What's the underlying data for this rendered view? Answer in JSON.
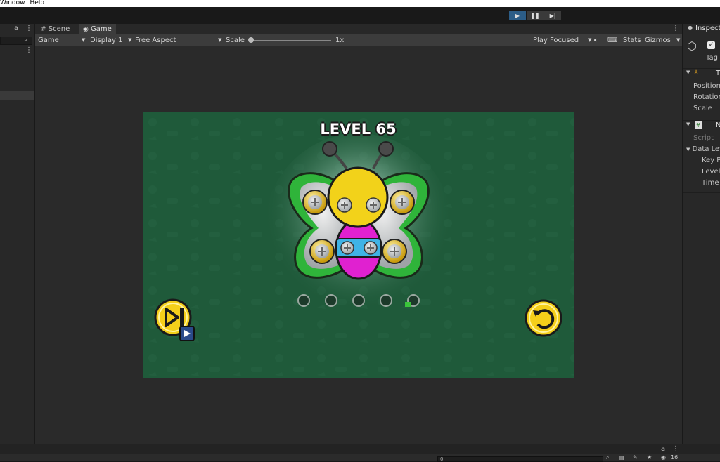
{
  "menubar": {
    "items": [
      "Window",
      "Help"
    ]
  },
  "game_tabs": {
    "scene": "Scene",
    "game": "Game"
  },
  "gamebar": {
    "view_mode": "Game",
    "display": "Display 1",
    "aspect": "Free Aspect",
    "scale_label": "Scale",
    "scale_value": "1x",
    "play_mode": "Play Focused",
    "stats": "Stats",
    "gizmos": "Gizmos"
  },
  "game": {
    "level_title": "LEVEL 65",
    "progress_total": 5,
    "progress_current": 5
  },
  "inspector": {
    "title": "Inspecto",
    "tag": "Tag",
    "transform_initial": "T",
    "position": "Position",
    "rotation": "Rotation",
    "scale": "Scale",
    "component_initial": "N",
    "script": "Script",
    "data_level": "Data Leve",
    "key": "Key P",
    "level": "Level",
    "time": "Time"
  },
  "bottom": {
    "count": "16",
    "search_value": "0"
  },
  "colors": {
    "bg_game": "#1f5a3a",
    "accent_play": "#2c5d87",
    "wing": "#2fb43a",
    "body_yellow": "#f2d21a",
    "body_pink": "#e021d0",
    "body_cyan": "#3fb3e6"
  }
}
